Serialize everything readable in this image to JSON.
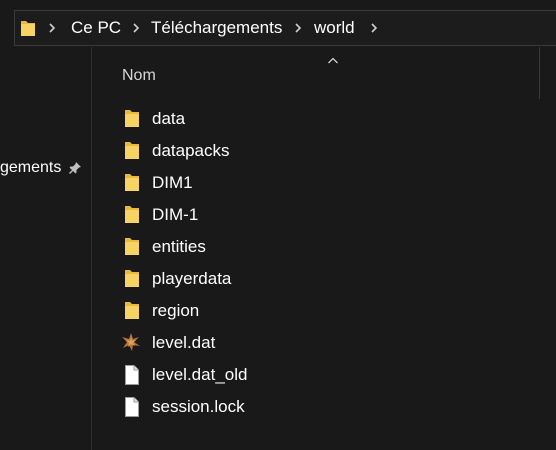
{
  "breadcrumb": {
    "items": [
      "Ce PC",
      "Téléchargements",
      "world"
    ]
  },
  "nav": {
    "pinned_label": "gements"
  },
  "list": {
    "column_name": "Nom",
    "files": [
      {
        "name": "data",
        "type": "folder"
      },
      {
        "name": "datapacks",
        "type": "folder"
      },
      {
        "name": "DIM1",
        "type": "folder"
      },
      {
        "name": "DIM-1",
        "type": "folder"
      },
      {
        "name": "entities",
        "type": "folder"
      },
      {
        "name": "playerdata",
        "type": "folder"
      },
      {
        "name": "region",
        "type": "folder"
      },
      {
        "name": "level.dat",
        "type": "dat-file"
      },
      {
        "name": "level.dat_old",
        "type": "file"
      },
      {
        "name": "session.lock",
        "type": "file"
      }
    ]
  },
  "colors": {
    "background": "#191919",
    "folder": "#f2c94c",
    "text": "#ffffff"
  }
}
